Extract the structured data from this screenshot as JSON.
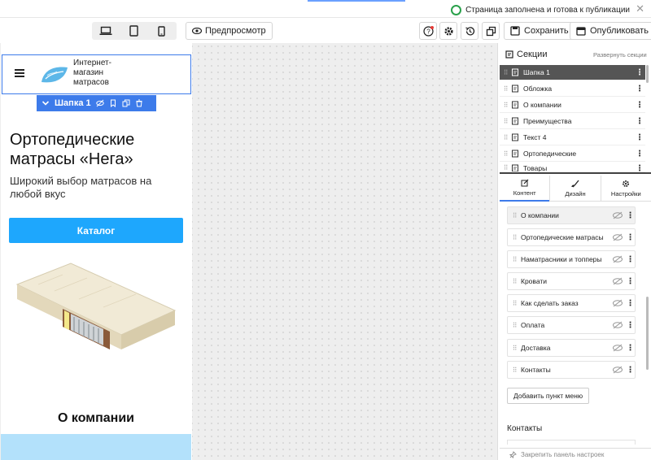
{
  "notice": {
    "text": "Страница заполнена и готова к публикации",
    "close": "✕"
  },
  "toolbar": {
    "preview_label": "Предпросмотр",
    "save_label": "Сохранить",
    "publish_label": "Опубликовать"
  },
  "site": {
    "brand": "Интернет-магазин матрасов",
    "header_bar_label": "Шапка 1",
    "hero_title": "Ортопедические матрасы «Нега»",
    "hero_subtitle": "Широкий выбор матрасов на любой вкус",
    "catalog_button": "Каталог",
    "about_title": "О компании"
  },
  "panel": {
    "sections_title": "Секции",
    "expand_sections": "Развернуть секции",
    "sections": [
      "Шапка 1",
      "Обложка",
      "О компании",
      "Преимущества",
      "Текст 4",
      "Ортопедические",
      "Товары"
    ],
    "tabs": [
      "Контент",
      "Дизайн",
      "Настройки"
    ],
    "menu_items": [
      "О компании",
      "Ортопедические матрасы",
      "Наматрасники и топперы",
      "Кровати",
      "Как сделать заказ",
      "Оплата",
      "Доставка",
      "Контакты"
    ],
    "add_menu_item": "Добавить пункт меню",
    "contacts_title": "Контакты",
    "pin_panel": "Закрепить панель настроек"
  },
  "colors": {
    "accent": "#3d7bea",
    "catalog_button": "#1ea7fd",
    "success": "#2aa14b"
  }
}
